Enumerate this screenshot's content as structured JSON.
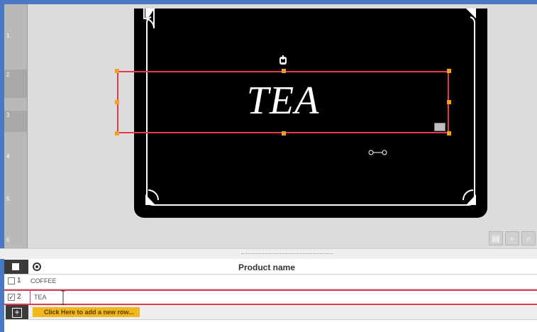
{
  "ruler": {
    "ticks": [
      "1",
      "2",
      "3",
      "4",
      "5",
      "6"
    ]
  },
  "canvas": {
    "label_text": "TEA",
    "icons": [
      "rotate-icon",
      "grid-icon",
      "link-icon"
    ],
    "zoom_tools": [
      "save-icon",
      "zoom-out-icon",
      "zoom-in-icon"
    ]
  },
  "table": {
    "header": {
      "column_title": "Product name"
    },
    "rows": [
      {
        "index": "1",
        "value": "COFFEE",
        "checked": false
      },
      {
        "index": "2",
        "value": "TEA",
        "checked": true
      }
    ],
    "add_row_label": "Click Here to add a new row..."
  },
  "colors": {
    "selection": "#e03a4f",
    "handle": "#f2a11f",
    "accent_tag": "#f0b81c",
    "frame": "#4a78c2"
  }
}
